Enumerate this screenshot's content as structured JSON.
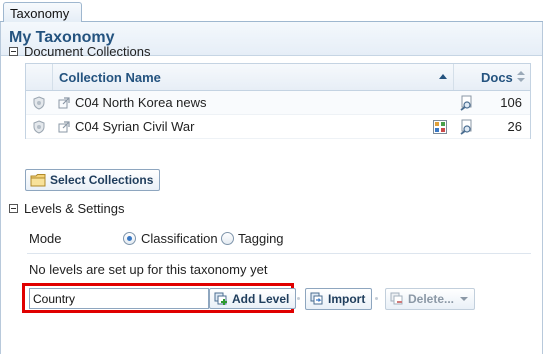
{
  "tab": {
    "label": "Taxonomy"
  },
  "panel": {
    "title": "My Taxonomy"
  },
  "collections": {
    "section_title": "Document Collections",
    "columns": {
      "name": "Collection Name",
      "docs": "Docs"
    },
    "rows": [
      {
        "name": "C04 North Korea news",
        "docs": "106"
      },
      {
        "name": "C04 Syrian Civil War",
        "docs": "26"
      }
    ],
    "select_button": "Select Collections"
  },
  "levels": {
    "section_title": "Levels & Settings",
    "mode_label": "Mode",
    "mode_options": [
      "Classification",
      "Tagging"
    ],
    "mode_selected": "Classification",
    "info_text": "No levels are set up for this taxonomy yet",
    "input_value": "Country",
    "add_level_button": "Add Level",
    "import_button": "Import",
    "delete_button": "Delete..."
  },
  "colors": {
    "accent": "#24537f",
    "highlight_box": "#e00000"
  },
  "icons": {
    "row_status": "shield-icon",
    "row_link": "external-link-icon",
    "row_tag": "tag-grid-icon",
    "row_search": "search-doc-icon",
    "select_collections": "folder-icon",
    "add_level": "add-level-icon",
    "import": "import-icon",
    "delete": "delete-icon"
  }
}
